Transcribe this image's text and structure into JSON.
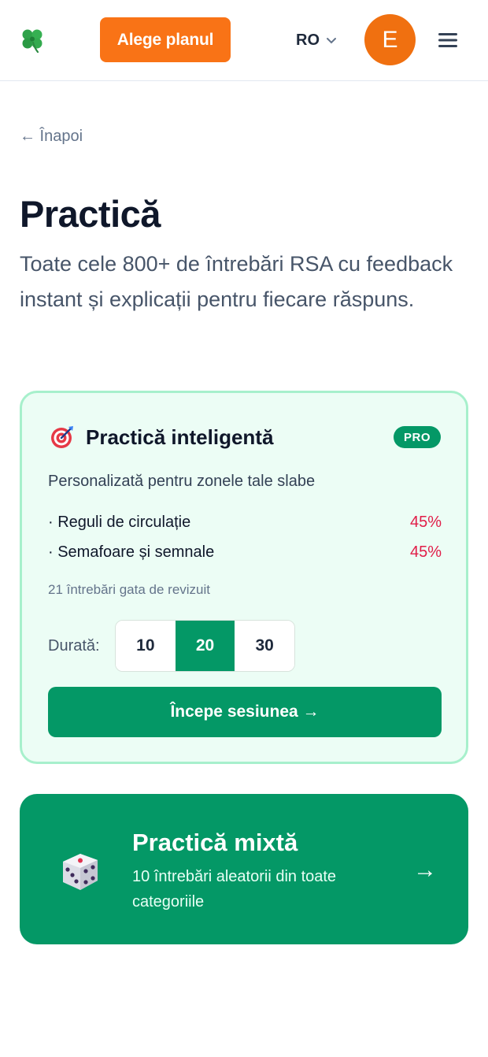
{
  "header": {
    "logo_icon": "four-leaf-clover-icon",
    "plan_button": "Alege planul",
    "language": "RO",
    "avatar_initial": "E",
    "menu_icon": "hamburger-menu-icon"
  },
  "back_link": "← Înapoi",
  "page": {
    "title": "Practică",
    "subtitle": "Toate cele 800+ de întrebări RSA cu feedback instant și explicații pentru fiecare răspuns."
  },
  "smart_practice": {
    "icon": "target-icon",
    "title": "Practică inteligentă",
    "badge": "PRO",
    "description": "Personalizată pentru zonele tale slabe",
    "weak_areas": [
      {
        "label": "· Reguli de circulație",
        "percent": "45%"
      },
      {
        "label": "· Semafoare și semnale",
        "percent": "45%"
      }
    ],
    "ready_text": "21 întrebări gata de revizuit",
    "duration_label": "Durată:",
    "duration_options": [
      "10",
      "20",
      "30"
    ],
    "duration_selected": "20",
    "start_button": "Începe sesiunea →"
  },
  "mixed_practice": {
    "icon": "dice-icon",
    "title": "Practică mixtă",
    "description": "10 întrebări aleatorii din toate categoriile",
    "arrow": "→"
  },
  "colors": {
    "accent_orange": "#f97316",
    "brand_green": "#049866",
    "card_bg": "#ecfdf5",
    "card_border": "#a7f0cc",
    "weak_percent": "#e11d48"
  }
}
